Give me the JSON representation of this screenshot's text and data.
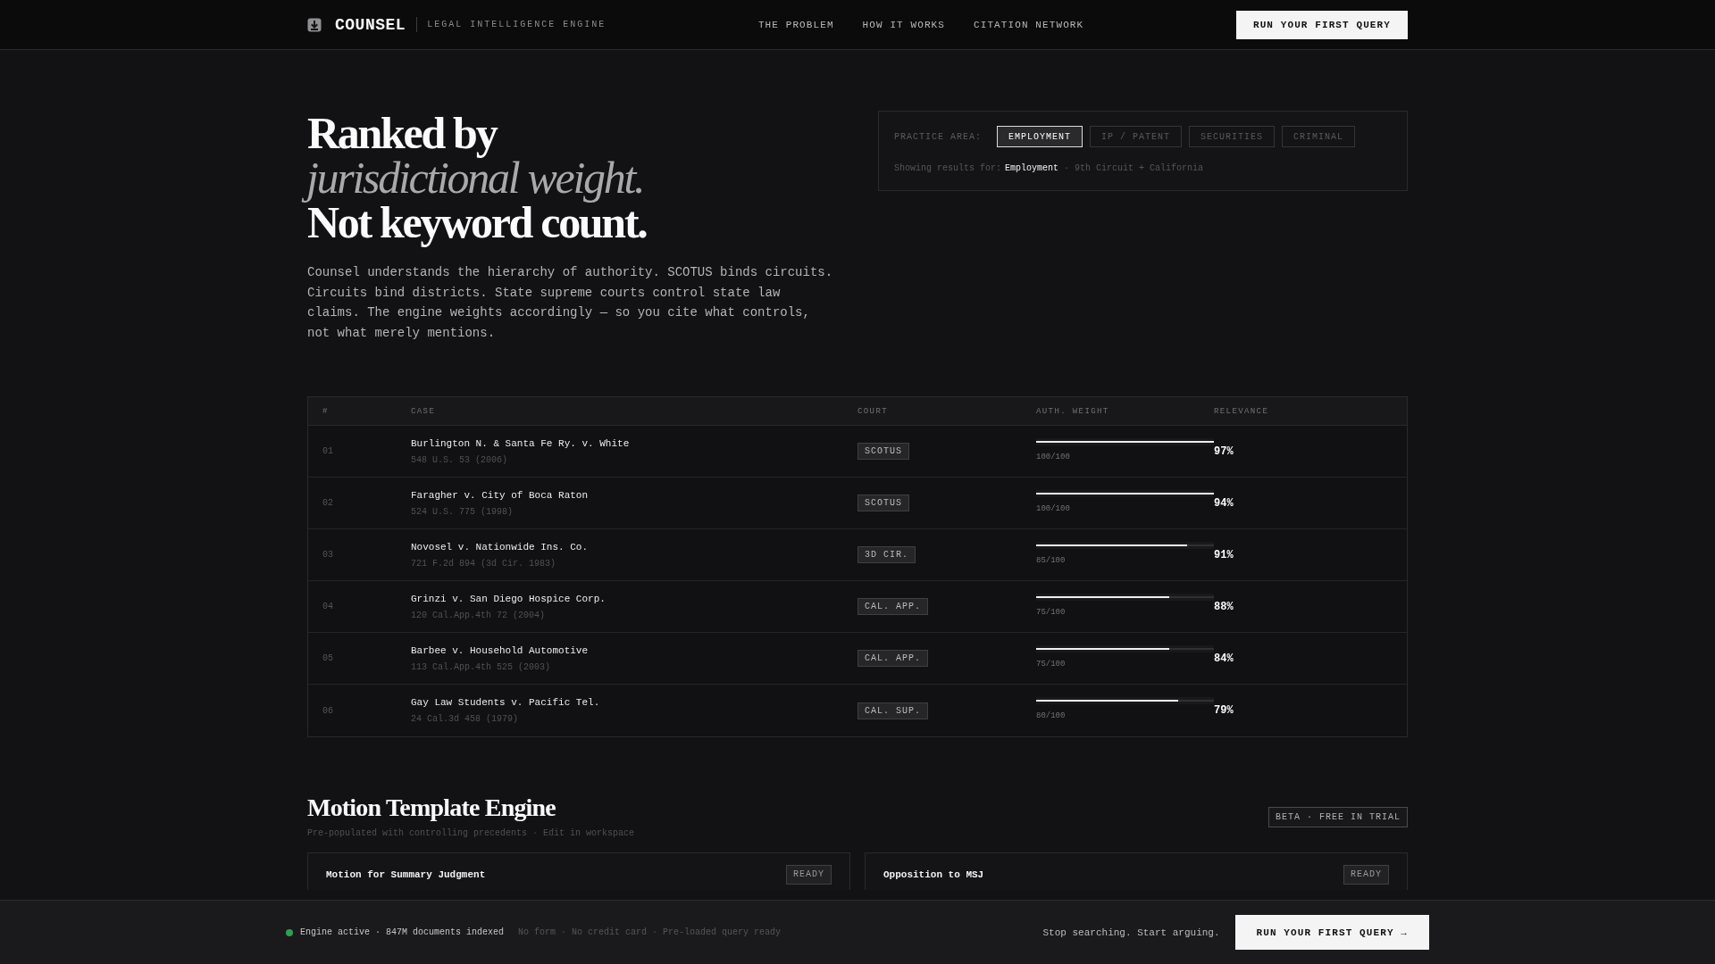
{
  "header": {
    "brand": "COUNSEL",
    "tagline": "LEGAL INTELLIGENCE ENGINE",
    "nav": [
      {
        "label": "THE PROBLEM"
      },
      {
        "label": "HOW IT WORKS"
      },
      {
        "label": "CITATION NETWORK"
      }
    ],
    "cta": "RUN YOUR FIRST QUERY"
  },
  "hero": {
    "title_lines": [
      {
        "kind": "plain",
        "text": "Ranked by"
      },
      {
        "kind": "italic",
        "text": "jurisdictional weight."
      },
      {
        "kind": "plain",
        "text": "Not keyword count."
      }
    ],
    "body": "Counsel understands the hierarchy of authority. SCOTUS binds circuits. Circuits bind districts. State supreme courts control state law claims. The engine weights accordingly — so you cite what controls, not what merely mentions."
  },
  "filter": {
    "label": "PRACTICE AREA:",
    "tabs": [
      {
        "label": "EMPLOYMENT",
        "selected": true
      },
      {
        "label": "IP / PATENT",
        "selected": false
      },
      {
        "label": "SECURITIES",
        "selected": false
      },
      {
        "label": "CRIMINAL",
        "selected": false
      }
    ],
    "summary": {
      "prefix": "Showing results for:",
      "area": "Employment",
      "separator": "·",
      "scope": "9th Circuit + California"
    }
  },
  "table": {
    "columns": [
      "#",
      "CASE",
      "COURT",
      "AUTH. WEIGHT",
      "RELEVANCE"
    ],
    "rows": [
      {
        "rank": "01",
        "case": "Burlington N. & Santa Fe Ry. v. White",
        "citation": "548 U.S. 53 (2006)",
        "court": "SCOTUS",
        "level": 1,
        "weight": "100/100",
        "relevance": "97%"
      },
      {
        "rank": "02",
        "case": "Faragher v. City of Boca Raton",
        "citation": "524 U.S. 775 (1998)",
        "court": "SCOTUS",
        "level": 1,
        "weight": "100/100",
        "relevance": "94%"
      },
      {
        "rank": "03",
        "case": "Novosel v. Nationwide Ins. Co.",
        "citation": "721 F.2d 894 (3d Cir. 1983)",
        "court": "3D CIR.",
        "level": 0.85,
        "weight": "85/100",
        "relevance": "91%"
      },
      {
        "rank": "04",
        "case": "Grinzi v. San Diego Hospice Corp.",
        "citation": "120 Cal.App.4th 72 (2004)",
        "court": "CAL. APP.",
        "level": 0.75,
        "weight": "75/100",
        "relevance": "88%"
      },
      {
        "rank": "05",
        "case": "Barbee v. Household Automotive",
        "citation": "113 Cal.App.4th 525 (2003)",
        "court": "CAL. APP.",
        "level": 0.75,
        "weight": "75/100",
        "relevance": "84%"
      },
      {
        "rank": "06",
        "case": "Gay Law Students v. Pacific Tel.",
        "citation": "24 Cal.3d 458 (1979)",
        "court": "CAL. SUP.",
        "level": 0.8,
        "weight": "80/100",
        "relevance": "79%"
      }
    ]
  },
  "motion": {
    "title": "Motion Template Engine",
    "subtitle": "Pre-populated with controlling precedents · Edit in workspace",
    "badge": "BETA · FREE IN TRIAL",
    "templates": [
      {
        "title": "Motion for Summary Judgment",
        "status": "READY"
      },
      {
        "title": "Opposition to MSJ",
        "status": "READY"
      }
    ]
  },
  "status_bar": {
    "active": true,
    "status": "Engine active · 847M documents indexed",
    "notes": "No form · No credit card · Pre-loaded query ready",
    "tagline": "Stop searching. Start arguing.",
    "cta": "RUN YOUR FIRST QUERY →"
  }
}
